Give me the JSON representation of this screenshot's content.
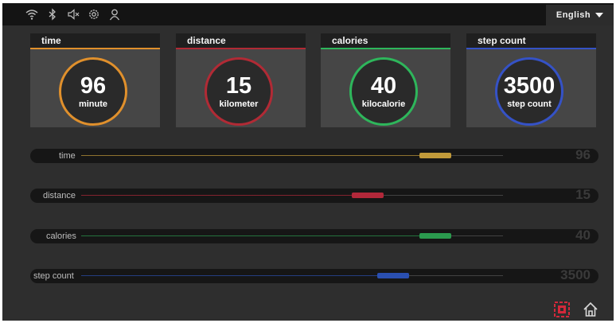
{
  "header": {
    "icons": [
      "wifi-icon",
      "bluetooth-icon",
      "mute-icon",
      "settings-icon",
      "user-icon"
    ],
    "language": "English"
  },
  "stats": [
    {
      "title": "time",
      "value": "96",
      "unit": "minute",
      "color": "#e0902c"
    },
    {
      "title": "distance",
      "value": "15",
      "unit": "kilometer",
      "color": "#b12a35"
    },
    {
      "title": "calories",
      "value": "40",
      "unit": "kilocalorie",
      "color": "#2eb65b"
    },
    {
      "title": "step count",
      "value": "3500",
      "unit": "step count",
      "color": "#3552c6"
    }
  ],
  "bars": [
    {
      "label": "time",
      "value": "96",
      "color": "#c19a3a",
      "level": 0.84
    },
    {
      "label": "distance",
      "value": "15",
      "color": "#b2283a",
      "level": 0.68
    },
    {
      "label": "calories",
      "value": "40",
      "color": "#2b9a4e",
      "level": 0.84
    },
    {
      "label": "step count",
      "value": "3500",
      "color": "#2a4fb0",
      "level": 0.74
    }
  ],
  "footer": {
    "icons": [
      "target-icon",
      "home-icon"
    ],
    "accent": "#d3283a"
  }
}
